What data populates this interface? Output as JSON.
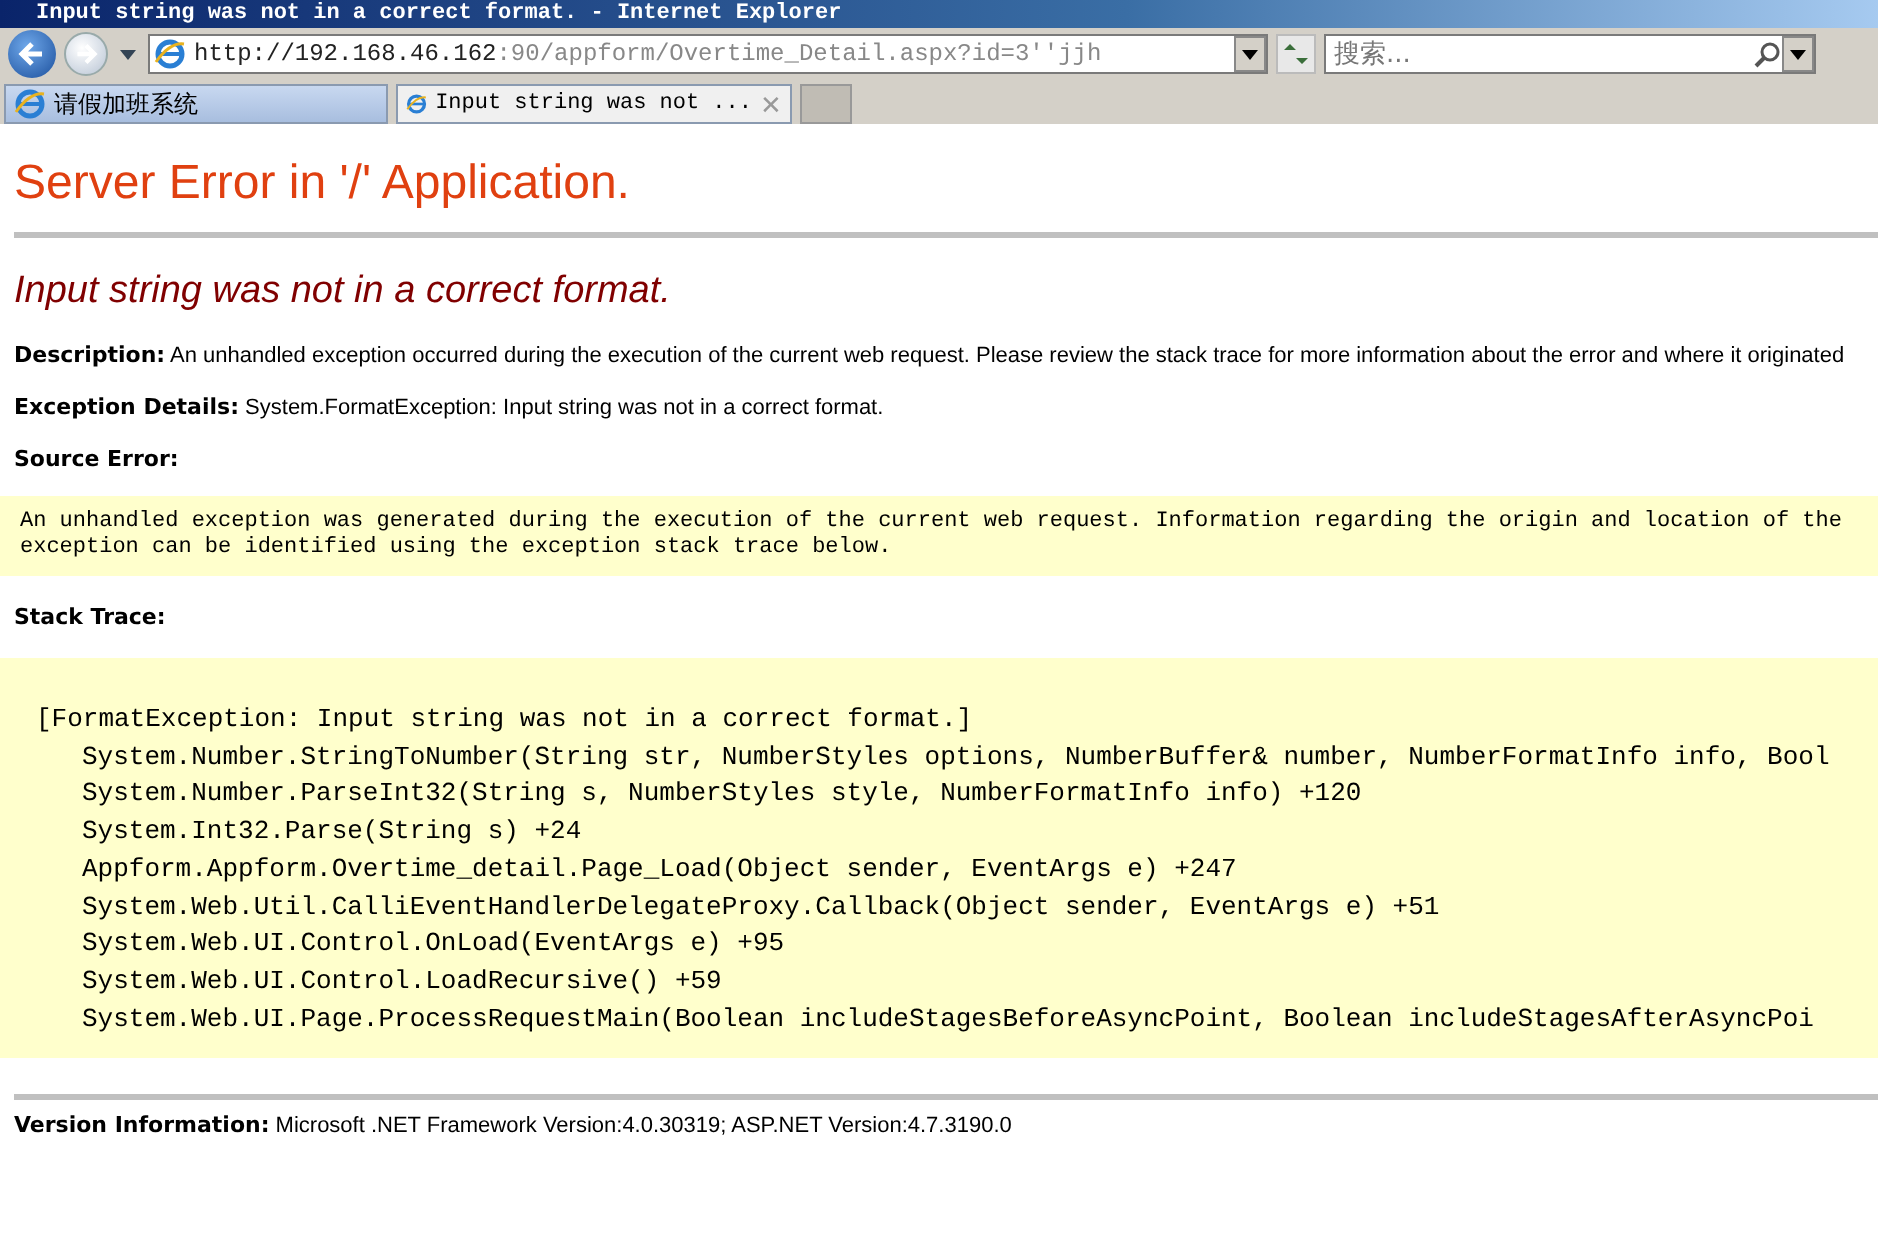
{
  "window": {
    "title": "Input string was not in a correct format. - Internet Explorer"
  },
  "address_bar": {
    "url_host": "http://192.168.46.162",
    "url_rest": ":90/appform/Overtime_Detail.aspx?id=3''jjh"
  },
  "search": {
    "placeholder": "搜索..."
  },
  "tabs": [
    {
      "label": "请假加班系统",
      "selected": false
    },
    {
      "label": "Input string was not ...",
      "selected": true,
      "close_label": "✕"
    }
  ],
  "page": {
    "heading": "Server Error in '/' Application.",
    "error_title": "Input string was not in a correct format.",
    "description": {
      "label": "Description:",
      "text": "An unhandled exception occurred during the execution of the current web request. Please review the stack trace for more information about the error and where it originated"
    },
    "exception_details": {
      "label": "Exception Details:",
      "text": "System.FormatException: Input string was not in a correct format."
    },
    "source_error": {
      "label": "Source Error:",
      "lines": [
        "An unhandled exception was generated during the execution of the current web request. Information regarding the origin and location of the",
        "exception can be identified using the exception stack trace below."
      ]
    },
    "stack_trace": {
      "label": "Stack Trace:",
      "exception": "[FormatException: Input string was not in a correct format.]",
      "frames": [
        "System.Number.StringToNumber(String str, NumberStyles options, NumberBuffer& number, NumberFormatInfo info, Bool",
        "System.Number.ParseInt32(String s, NumberStyles style, NumberFormatInfo info) +120",
        "System.Int32.Parse(String s) +24",
        "Appform.Appform.Overtime_detail.Page_Load(Object sender, EventArgs e) +247",
        "System.Web.Util.CalliEventHandlerDelegateProxy.Callback(Object sender, EventArgs e) +51",
        "System.Web.UI.Control.OnLoad(EventArgs e) +95",
        "System.Web.UI.Control.LoadRecursive() +59",
        "System.Web.UI.Page.ProcessRequestMain(Boolean includeStagesBeforeAsyncPoint, Boolean includeStagesAfterAsyncPoi"
      ]
    },
    "version": {
      "label": "Version Information:",
      "text": "Microsoft .NET Framework Version:4.0.30319; ASP.NET Version:4.7.3190.0"
    }
  }
}
